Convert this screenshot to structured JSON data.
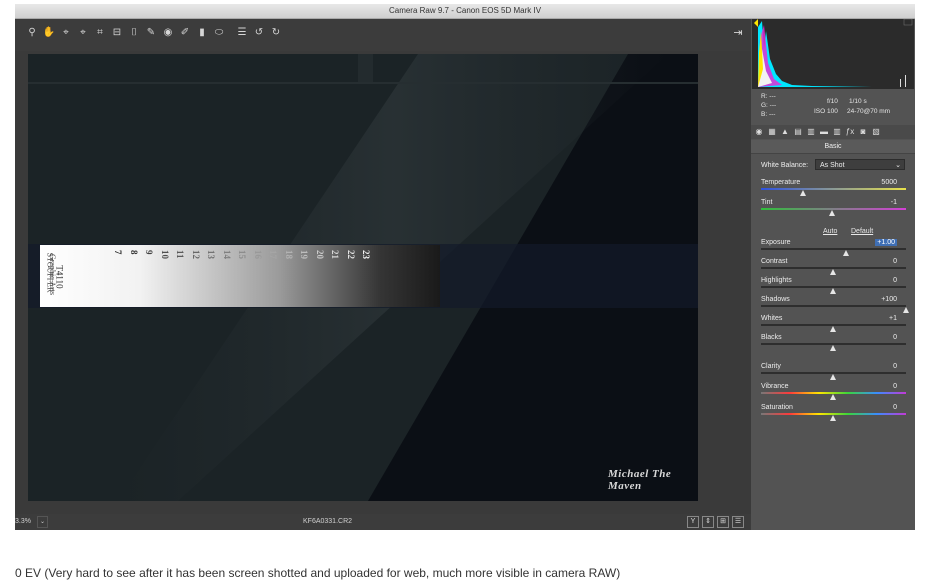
{
  "window": {
    "title": "Camera Raw 9.7  -  Canon EOS 5D Mark IV"
  },
  "toolbar": {
    "tools": [
      {
        "name": "zoom-tool-icon",
        "glyph": "⚲"
      },
      {
        "name": "hand-tool-icon",
        "glyph": "✋"
      },
      {
        "name": "white-balance-tool-icon",
        "glyph": "⌖"
      },
      {
        "name": "color-sampler-tool-icon",
        "glyph": "⌖"
      },
      {
        "name": "crop-tool-icon",
        "glyph": "⌗"
      },
      {
        "name": "straighten-tool-icon",
        "glyph": "⊟"
      },
      {
        "name": "transform-tool-icon",
        "glyph": "⌷"
      },
      {
        "name": "spot-removal-tool-icon",
        "glyph": "✎"
      },
      {
        "name": "red-eye-tool-icon",
        "glyph": "◉"
      },
      {
        "name": "adjustment-brush-icon",
        "glyph": "✐"
      },
      {
        "name": "graduated-filter-icon",
        "glyph": "▮"
      },
      {
        "name": "radial-filter-icon",
        "glyph": "⬭"
      },
      {
        "name": "preferences-icon",
        "glyph": "☰"
      },
      {
        "name": "rotate-ccw-icon",
        "glyph": "↺"
      },
      {
        "name": "rotate-cw-icon",
        "glyph": "↻"
      }
    ],
    "right_tool": {
      "name": "open-export-icon",
      "glyph": "⇥"
    }
  },
  "status": {
    "zoom": "3.3%",
    "filename": "KF6A0331.CR2",
    "right_icons": [
      "Y",
      "⇕",
      "⊞",
      "☰"
    ]
  },
  "image": {
    "strip_brand_line1": "STOUFFER",
    "strip_brand_line2": "Graphic Arts",
    "strip_brand_line3": "T4110",
    "step_numbers": [
      "7",
      "8",
      "9",
      "10",
      "11",
      "12",
      "13",
      "14",
      "15",
      "16",
      "17",
      "18",
      "19",
      "20",
      "21",
      "22",
      "23"
    ],
    "watermark": "Michael The Maven"
  },
  "panel": {
    "camera_info": {
      "r": "R:   ---",
      "g": "G:   ---",
      "b": "B:   ---",
      "aperture": "f/10",
      "shutter": "1/10 s",
      "iso": "ISO 100",
      "lens": "24-70@70 mm"
    },
    "tabs": [
      "basic-tab-icon",
      "tone-curve-tab-icon",
      "detail-tab-icon",
      "hsl-tab-icon",
      "split-toning-tab-icon",
      "lens-tab-icon",
      "effects-tab-icon",
      "camera-calibration-tab-icon",
      "presets-tab-icon",
      "snapshots-tab-icon"
    ],
    "section_title": "Basic",
    "white_balance": {
      "label": "White Balance:",
      "value": "As Shot"
    },
    "auto_label": "Auto",
    "default_label": "Default",
    "controls": [
      {
        "label": "Temperature",
        "value": "5000",
        "pos": 0.29
      },
      {
        "label": "Tint",
        "value": "-1",
        "pos": 0.49
      },
      {
        "label": "Exposure",
        "value": "+1.00",
        "pos": 0.59
      },
      {
        "label": "Contrast",
        "value": "0",
        "pos": 0.5
      },
      {
        "label": "Highlights",
        "value": "0",
        "pos": 0.5
      },
      {
        "label": "Shadows",
        "value": "+100",
        "pos": 1.0
      },
      {
        "label": "Whites",
        "value": "+1",
        "pos": 0.5
      },
      {
        "label": "Blacks",
        "value": "0",
        "pos": 0.5
      },
      {
        "label": "Clarity",
        "value": "0",
        "pos": 0.5
      },
      {
        "label": "Vibrance",
        "value": "0",
        "pos": 0.5
      },
      {
        "label": "Saturation",
        "value": "0",
        "pos": 0.5
      }
    ]
  },
  "caption": "0 EV (Very hard to see after it has been screen shotted and uploaded for web, much more visible in camera RAW)"
}
